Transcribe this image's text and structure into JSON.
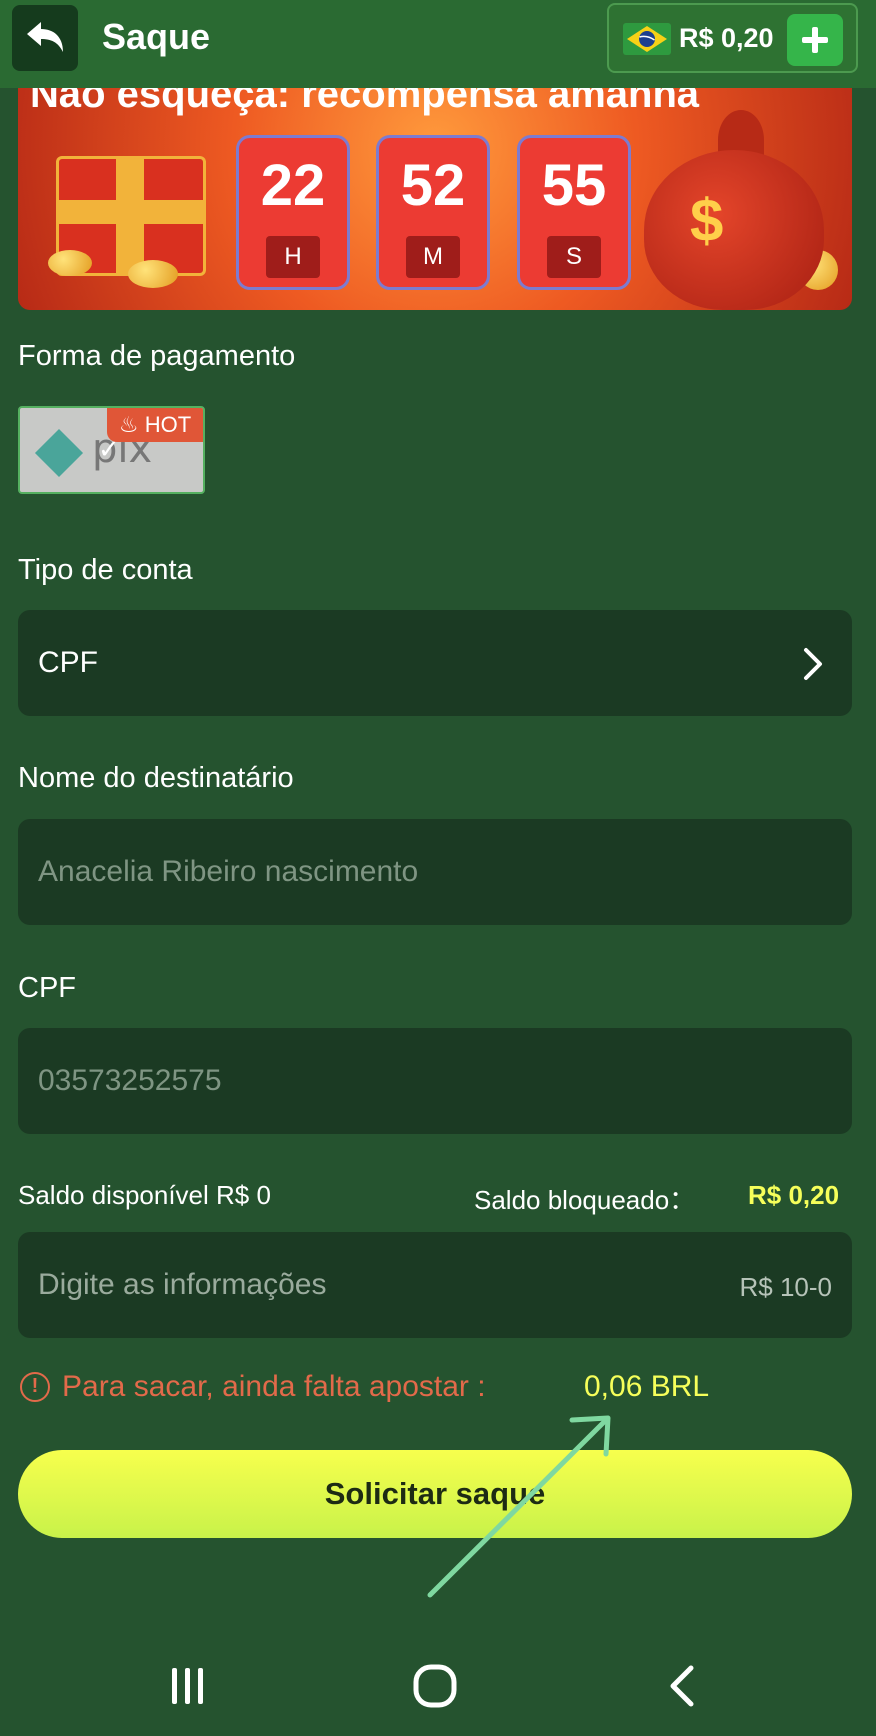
{
  "header": {
    "title": "Saque",
    "balance": "R$ 0,20"
  },
  "banner": {
    "headline": "Não esqueça: recompensa amanhã",
    "timer": [
      {
        "value": "22",
        "unit": "H"
      },
      {
        "value": "52",
        "unit": "M"
      },
      {
        "value": "55",
        "unit": "S"
      }
    ]
  },
  "payment": {
    "label": "Forma de pagamento",
    "method_name": "pix",
    "badge": "HOT"
  },
  "account_type": {
    "label": "Tipo de conta",
    "value": "CPF"
  },
  "recipient": {
    "label": "Nome do destinatário",
    "placeholder": "Anacelia Ribeiro nascimento"
  },
  "cpf": {
    "label": "CPF",
    "placeholder": "03573252575"
  },
  "saldo": {
    "available": "Saldo disponível R$ 0",
    "blocked_label": "Saldo bloqueado：",
    "blocked_value": "R$ 0,20"
  },
  "amount": {
    "placeholder": "Digite as informações",
    "range": "R$ 10-0"
  },
  "warning": {
    "text": "Para sacar, ainda falta apostar :",
    "value": "0,06 BRL"
  },
  "submit": {
    "label": "Solicitar saque"
  },
  "colors": {
    "background": "#25532f",
    "header": "#2a6a32",
    "field": "#1b3a23",
    "accent_yellow": "#f6ff5a",
    "warning": "#e26a4a",
    "annotation_arrow": "#7fd8a0"
  }
}
